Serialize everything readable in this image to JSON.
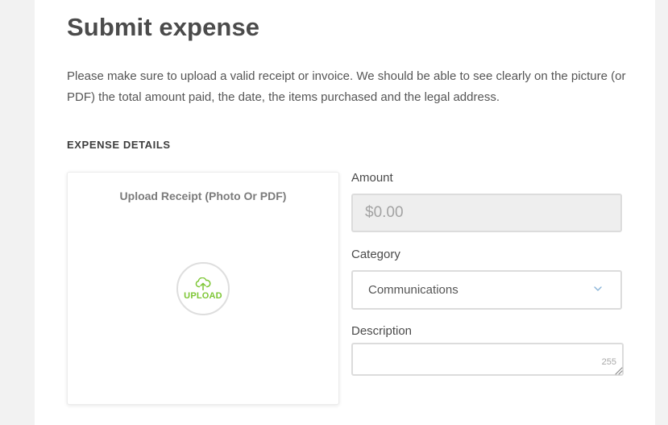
{
  "page": {
    "title": "Submit expense",
    "intro": "Please make sure to upload a valid receipt or invoice. We should be able to see clearly on the picture (or PDF) the total amount paid, the date, the items purchased and the legal address."
  },
  "expense_details": {
    "section_title": "EXPENSE DETAILS",
    "upload": {
      "label": "Upload Receipt (Photo Or PDF)",
      "button_text": "UPLOAD",
      "icon": "cloud-upload-icon",
      "accent_color": "#7dc634"
    },
    "amount": {
      "label": "Amount",
      "value": "",
      "placeholder": "$0.00"
    },
    "category": {
      "label": "Category",
      "selected": "Communications",
      "icon": "chevron-down-icon"
    },
    "description": {
      "label": "Description",
      "value": "",
      "max_length": "255"
    }
  }
}
